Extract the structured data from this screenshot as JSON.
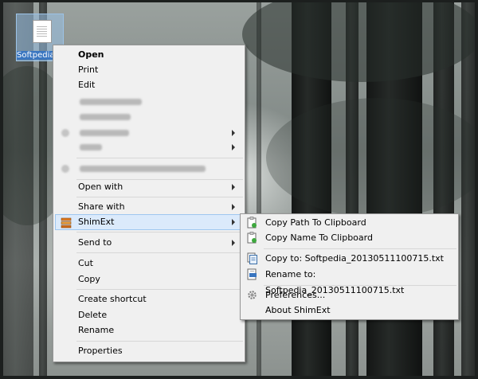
{
  "desktop_icon": {
    "label": "Softpedia..."
  },
  "context_menu": {
    "open": "Open",
    "print": "Print",
    "edit": "Edit",
    "open_with": "Open with",
    "share_with": "Share with",
    "shimext": "ShimExt",
    "send_to": "Send to",
    "cut": "Cut",
    "copy": "Copy",
    "create_shortcut": "Create shortcut",
    "delete": "Delete",
    "rename": "Rename",
    "properties": "Properties"
  },
  "submenu": {
    "copy_path": "Copy Path To Clipboard",
    "copy_name": "Copy Name To Clipboard",
    "copy_to": "Copy to: Softpedia_20130511100715.txt",
    "rename_to": "Rename to: Softpedia_20130511100715.txt",
    "preferences": "Preferences...",
    "about": "About ShimExt"
  },
  "colors": {
    "menu_bg": "#f0f0f0",
    "hover_bg": "#dbeafb",
    "hover_border": "#9fc7ef",
    "selection_blue": "#3a76c0"
  },
  "icons": {
    "shimext": "shimext-icon",
    "clipboard_copy": "clipboard-copy-icon",
    "copy_file": "copy-file-icon",
    "rename_file": "rename-file-icon",
    "preferences": "gear-icon"
  }
}
